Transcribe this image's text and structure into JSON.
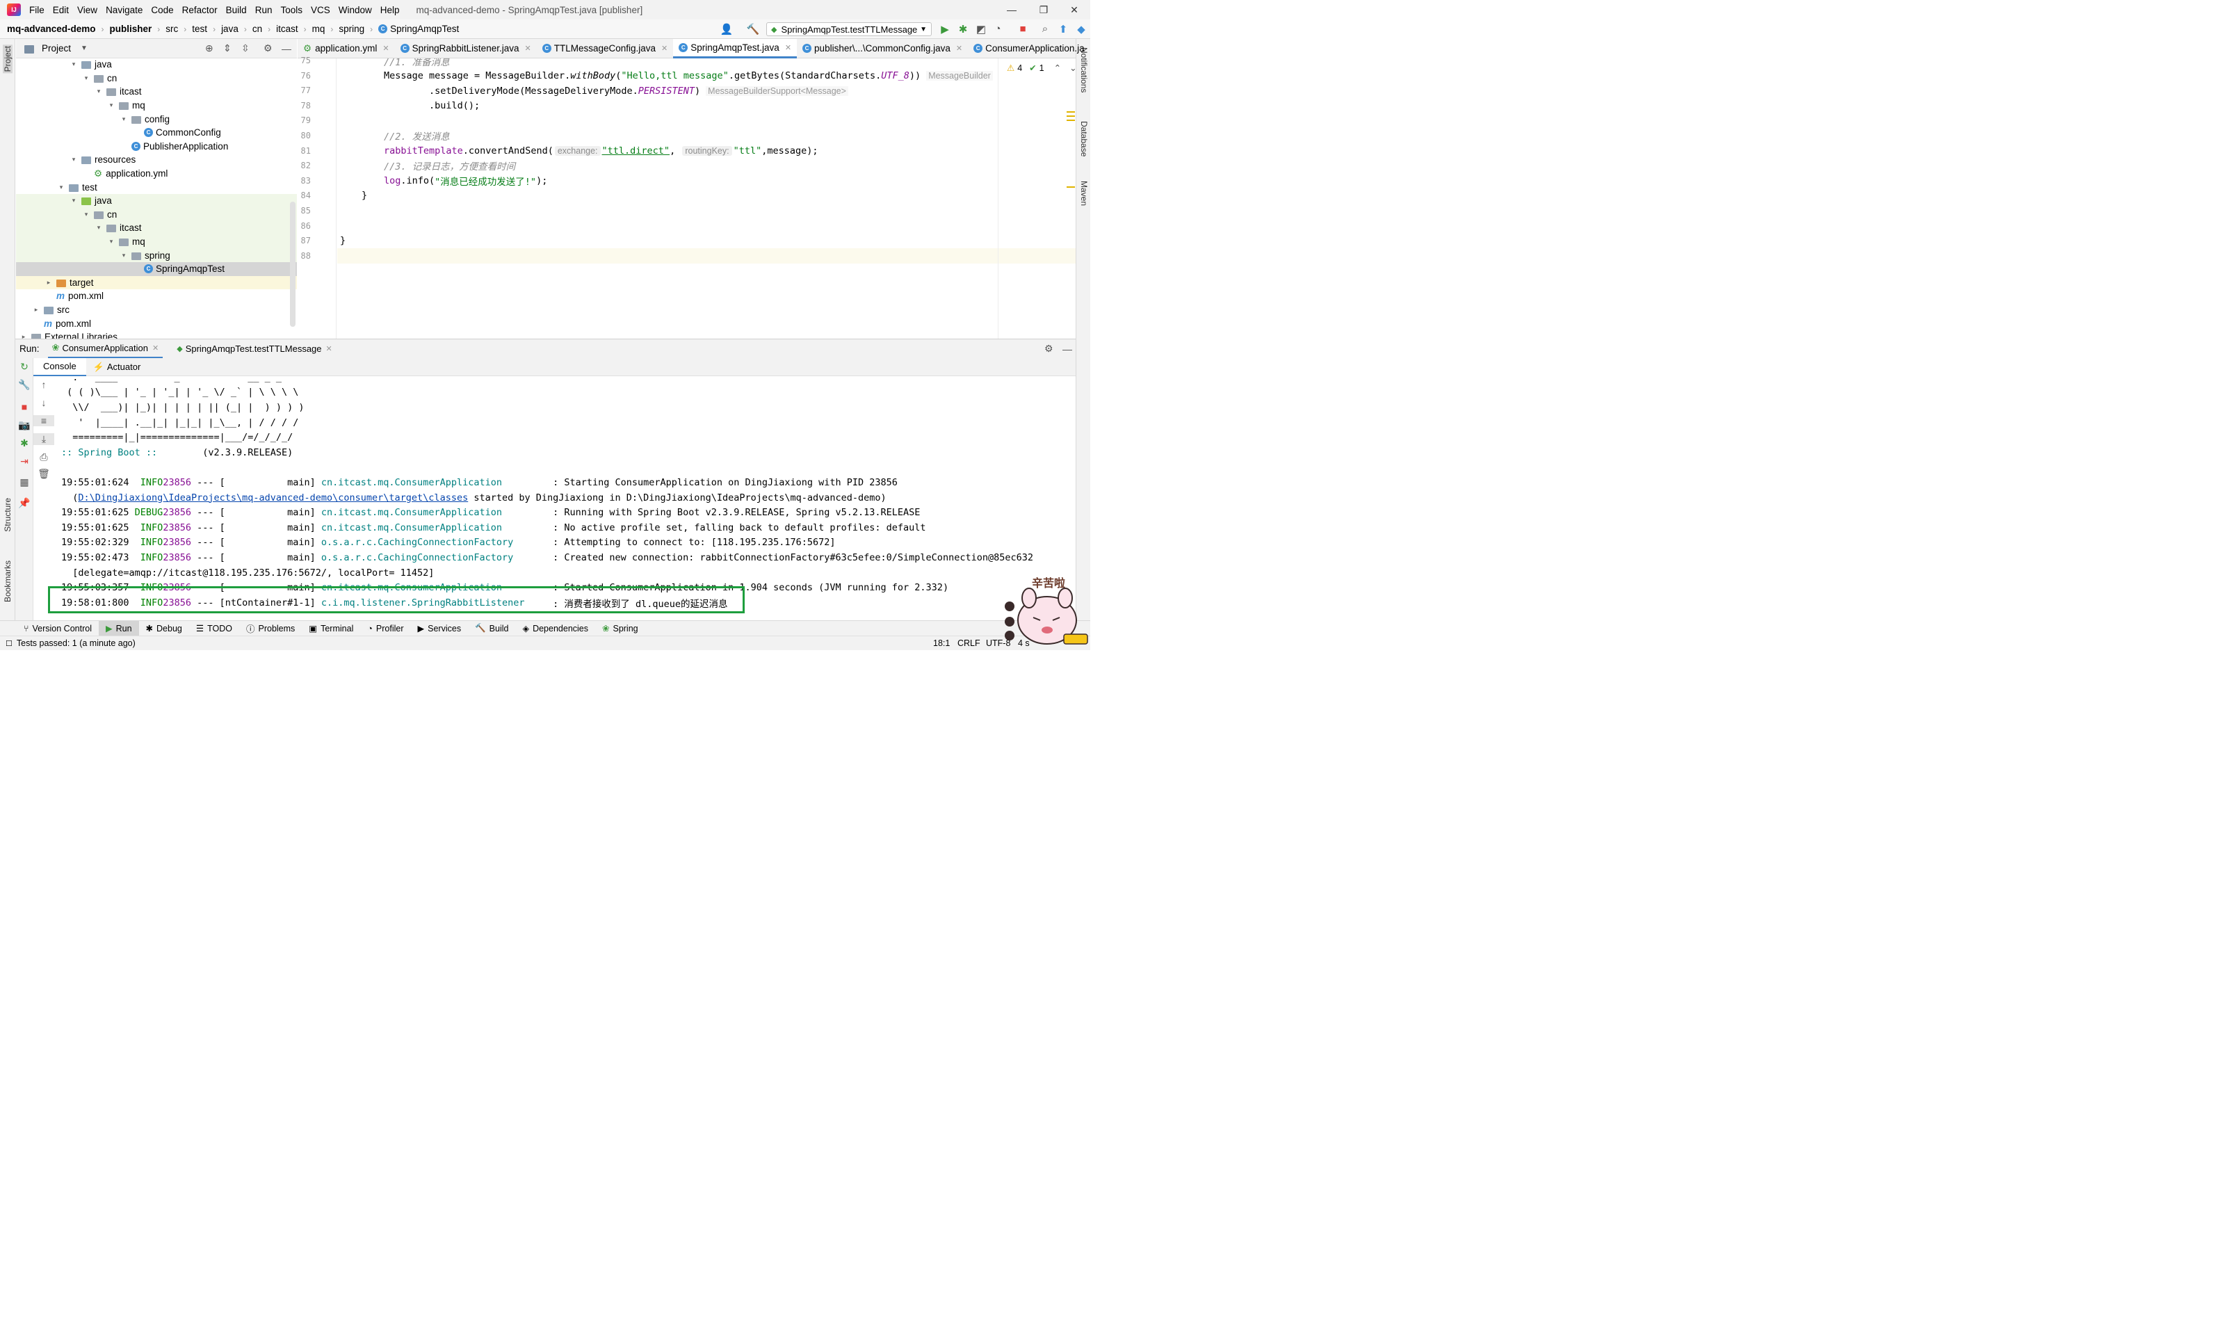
{
  "window": {
    "menu": [
      "File",
      "Edit",
      "View",
      "Navigate",
      "Code",
      "Refactor",
      "Build",
      "Run",
      "Tools",
      "VCS",
      "Window",
      "Help"
    ],
    "title": "mq-advanced-demo - SpringAmqpTest.java [publisher]",
    "min_icon": "minimize-icon",
    "max_icon": "restore-icon",
    "close_icon": "close-icon"
  },
  "nav": {
    "crumbs": [
      "mq-advanced-demo",
      "publisher",
      "src",
      "test",
      "java",
      "cn",
      "itcast",
      "mq",
      "spring",
      "SpringAmqpTest"
    ],
    "run_config": "SpringAmqpTest.testTTLMessage"
  },
  "project": {
    "header": "Project",
    "tree": [
      {
        "label": "java",
        "type": "folder-blue",
        "indent": 4,
        "expanded": true,
        "bg": ""
      },
      {
        "label": "cn",
        "type": "package",
        "indent": 5,
        "expanded": true,
        "bg": ""
      },
      {
        "label": "itcast",
        "type": "package",
        "indent": 6,
        "expanded": true,
        "bg": ""
      },
      {
        "label": "mq",
        "type": "package",
        "indent": 7,
        "expanded": true,
        "bg": ""
      },
      {
        "label": "config",
        "type": "package",
        "indent": 8,
        "expanded": true,
        "bg": ""
      },
      {
        "label": "CommonConfig",
        "type": "class",
        "indent": 9,
        "expanded": null,
        "bg": ""
      },
      {
        "label": "PublisherApplication",
        "type": "class-run",
        "indent": 8,
        "expanded": null,
        "bg": ""
      },
      {
        "label": "resources",
        "type": "folder-res",
        "indent": 4,
        "expanded": true,
        "bg": ""
      },
      {
        "label": "application.yml",
        "type": "yml",
        "indent": 5,
        "expanded": null,
        "bg": ""
      },
      {
        "label": "test",
        "type": "folder",
        "indent": 3,
        "expanded": true,
        "bg": ""
      },
      {
        "label": "java",
        "type": "folder-green",
        "indent": 4,
        "expanded": true,
        "bg": "green"
      },
      {
        "label": "cn",
        "type": "package",
        "indent": 5,
        "expanded": true,
        "bg": "green"
      },
      {
        "label": "itcast",
        "type": "package",
        "indent": 6,
        "expanded": true,
        "bg": "green"
      },
      {
        "label": "mq",
        "type": "package",
        "indent": 7,
        "expanded": true,
        "bg": "green"
      },
      {
        "label": "spring",
        "type": "package",
        "indent": 8,
        "expanded": true,
        "bg": "green"
      },
      {
        "label": "SpringAmqpTest",
        "type": "class",
        "indent": 9,
        "expanded": null,
        "bg": "sel"
      },
      {
        "label": "target",
        "type": "folder-orange",
        "indent": 2,
        "expanded": false,
        "bg": "yellow"
      },
      {
        "label": "pom.xml",
        "type": "maven",
        "indent": 2,
        "expanded": null,
        "bg": ""
      },
      {
        "label": "src",
        "type": "folder",
        "indent": 1,
        "expanded": false,
        "bg": ""
      },
      {
        "label": "pom.xml",
        "type": "maven",
        "indent": 1,
        "expanded": null,
        "bg": ""
      },
      {
        "label": "External Libraries",
        "type": "lib",
        "indent": 0,
        "expanded": false,
        "bg": ""
      }
    ]
  },
  "editor": {
    "tabs": [
      {
        "label": "application.yml",
        "active": false
      },
      {
        "label": "SpringRabbitListener.java",
        "active": false
      },
      {
        "label": "TTLMessageConfig.java",
        "active": false
      },
      {
        "label": "SpringAmqpTest.java",
        "active": true
      },
      {
        "label": "publisher\\...\\CommonConfig.java",
        "active": false
      },
      {
        "label": "ConsumerApplication.ja",
        "active": false
      }
    ],
    "line_numbers": [
      "75",
      "76",
      "77",
      "78",
      "79",
      "80",
      "81",
      "82",
      "83",
      "84",
      "85",
      "86",
      "87",
      "88"
    ],
    "warnings": "4",
    "checks": "1",
    "code": {
      "l75_comment": "//1. 准备消息",
      "l76_a": "Message message = MessageBuilder.",
      "l76_fn": "withBody",
      "l76_b": "(",
      "l76_str": "\"Hello,ttl message\"",
      "l76_c": ".getBytes(StandardCharsets.",
      "l76_const": "UTF_8",
      "l76_d": "))",
      "l76_hint": "MessageBuilder",
      "l77_a": "        .setDeliveryMode(MessageDeliveryMode.",
      "l77_const": "PERSISTENT",
      "l77_b": ")",
      "l77_hint": "MessageBuilderSupport<Message>",
      "l78": "        .build();",
      "l80_comment": "//2. 发送消息",
      "l81_a": "rabbitTemplate",
      "l81_b": ".convertAndSend(",
      "l81_hint1": "exchange:",
      "l81_str1": "\"ttl.direct\"",
      "l81_c": ", ",
      "l81_hint2": "routingKey:",
      "l81_str2": "\"ttl\"",
      "l81_d": ",message);",
      "l82_comment": "//3. 记录日志，方便查看时间",
      "l83_a": "log",
      "l83_b": ".info(",
      "l83_str": "\"消息已经成功发送了!\"",
      "l83_c": ");",
      "l84": "}",
      "l87": "}"
    }
  },
  "run": {
    "label": "Run:",
    "tabs": [
      "ConsumerApplication",
      "SpringAmqpTest.testTTLMessage"
    ],
    "subtabs": [
      "Console",
      "Actuator"
    ],
    "banner": [
      "  .   ____          _            __ _ _",
      " ( ( )\\___ | '_ | '_| | '_ \\/ _` | \\ \\ \\ \\",
      "  \\\\/  ___)| |_)| | | | | || (_| |  ) ) ) )",
      "   '  |____| .__|_| |_|_| |_\\__, | / / / /",
      "  =========|_|==============|___/=/_/_/_/",
      "  :: Spring Boot ::        (v2.3.9.RELEASE)"
    ],
    "logs": [
      {
        "time": "19:55:01:624",
        "level": " INFO",
        "pid": "23856",
        "dash": " --- [",
        "thread": "           main]",
        "cls": "cn.itcast.mq.ConsumerApplication        ",
        "msg": " : Starting ConsumerApplication on DingJiaxiong with PID 23856"
      },
      {
        "time": "19:55:01:625",
        "level": "DEBUG",
        "pid": "23856",
        "dash": " --- [",
        "thread": "           main]",
        "cls": "cn.itcast.mq.ConsumerApplication        ",
        "msg": " : Running with Spring Boot v2.3.9.RELEASE, Spring v5.2.13.RELEASE"
      },
      {
        "time": "19:55:01:625",
        "level": " INFO",
        "pid": "23856",
        "dash": " --- [",
        "thread": "           main]",
        "cls": "cn.itcast.mq.ConsumerApplication        ",
        "msg": " : No active profile set, falling back to default profiles: default"
      },
      {
        "time": "19:55:02:329",
        "level": " INFO",
        "pid": "23856",
        "dash": " --- [",
        "thread": "           main]",
        "cls": "o.s.a.r.c.CachingConnectionFactory      ",
        "msg": " : Attempting to connect to: [118.195.235.176:5672]"
      },
      {
        "time": "19:55:02:473",
        "level": " INFO",
        "pid": "23856",
        "dash": " --- [",
        "thread": "           main]",
        "cls": "o.s.a.r.c.CachingConnectionFactory      ",
        "msg": " : Created new connection: rabbitConnectionFactory#63c5efee:0/SimpleConnection@85ec632"
      },
      {
        "time": "19:55:03:357",
        "level": " INFO",
        "pid": "23856",
        "dash": " --- [",
        "thread": "           main]",
        "cls": "cn.itcast.mq.ConsumerApplication        ",
        "msg": " : Started ConsumerApplication in 1.904 seconds (JVM running for 2.332)"
      },
      {
        "time": "19:58:01:800",
        "level": " INFO",
        "pid": "23856",
        "dash": " --- [",
        "thread": "ntContainer#1-1]",
        "cls": "c.i.mq.listener.SpringRabbitListener    ",
        "msg": " : 消费者接收到了 dl.queue的延迟消息"
      }
    ],
    "path_line_a": "  (",
    "path_link": "D:\\DingJiaxiong\\IdeaProjects\\mq-advanced-demo\\consumer\\target\\classes",
    "path_line_b": " started by DingJiaxiong in D:\\DingJiaxiong\\IdeaProjects\\mq-advanced-demo)",
    "delegate_line": "  [delegate=amqp://itcast@118.195.235.176:5672/, localPort= 11452]"
  },
  "bottom_tools": [
    "Version Control",
    "Run",
    "Debug",
    "TODO",
    "Problems",
    "Terminal",
    "Profiler",
    "Services",
    "Build",
    "Dependencies",
    "Spring"
  ],
  "status": {
    "left": "Tests passed: 1 (a minute ago)",
    "pos": "18:1",
    "eol": "CRLF",
    "enc": "UTF-8",
    "indent": "4 s"
  },
  "right_strip": [
    "Notifications",
    "Database",
    "Maven"
  ],
  "left_strip": [
    "Project",
    "Structure",
    "Bookmarks"
  ],
  "sticker": {
    "text": "辛苦啦"
  },
  "colors": {
    "accent": "#4083c9",
    "highlight_box": "#1e9e3e",
    "run_green": "#3c9a3c",
    "stop_red": "#e0413c"
  }
}
